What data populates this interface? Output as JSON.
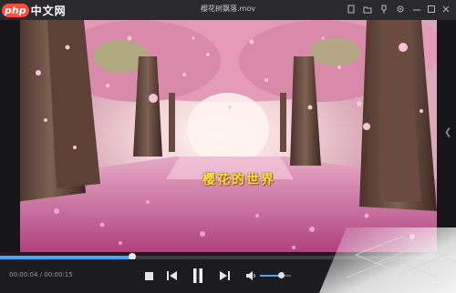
{
  "window": {
    "title": "樱花树飘落.mov"
  },
  "logo": {
    "text_php": "php",
    "text_cn": "中文网"
  },
  "titlebar": {
    "buttons": [
      {
        "name": "file-icon"
      },
      {
        "name": "folder-icon"
      },
      {
        "name": "pin-icon"
      },
      {
        "name": "minimize-icon"
      },
      {
        "name": "maximize-icon"
      },
      {
        "name": "close-icon"
      }
    ]
  },
  "video": {
    "subtitle": "樱花的世界"
  },
  "playback": {
    "current_time": "00:00:04",
    "total_time": "00:00:15",
    "separator": " / ",
    "progress": 0.29
  },
  "volume": {
    "level": 0.7
  },
  "colors": {
    "accent": "#4aa3ff",
    "logo_bg": "#ff4b3a"
  }
}
